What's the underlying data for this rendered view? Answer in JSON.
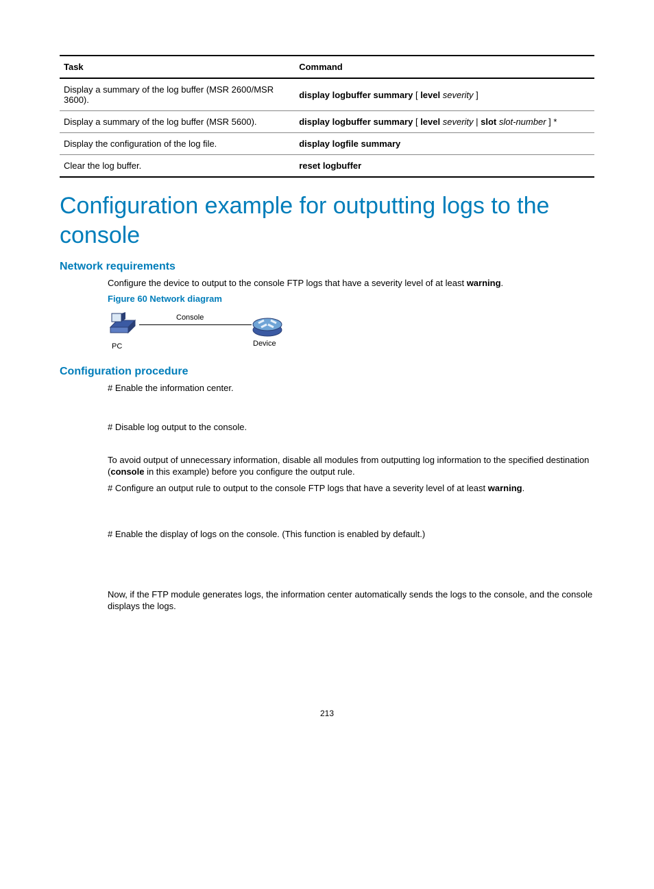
{
  "table": {
    "headers": {
      "task": "Task",
      "command": "Command"
    },
    "rows": [
      {
        "task": "Display a summary of the log buffer (MSR 2600/MSR 3600).",
        "cmd_parts": {
          "p1": "display logbuffer summary",
          "p2": " [ ",
          "p3": "level",
          "p4": " ",
          "p5": "severity",
          "p6": " ]"
        }
      },
      {
        "task": "Display a summary of the log buffer (MSR 5600).",
        "cmd_parts": {
          "p1": "display logbuffer summary",
          "p2": " [ ",
          "p3": "level",
          "p4": " ",
          "p5": "severity",
          "p6": " | ",
          "p7": "slot",
          "p8": " ",
          "p9": "slot-number",
          "p10": " ] *"
        }
      },
      {
        "task": "Display the configuration of the log file.",
        "cmd_simple": "display logfile summary"
      },
      {
        "task": "Clear the log buffer.",
        "cmd_simple": "reset logbuffer"
      }
    ]
  },
  "heading": "Configuration example for outputting logs to the console",
  "section1": {
    "title": "Network requirements",
    "para": {
      "a": "Configure the device to output to the console FTP logs that have a severity level of at least ",
      "b": "warning",
      "c": "."
    },
    "figcap": "Figure 60 Network diagram",
    "labels": {
      "pc": "PC",
      "device": "Device",
      "console": "Console"
    }
  },
  "section2": {
    "title": "Configuration procedure",
    "p1": "# Enable the information center.",
    "p2": "# Disable log output to the console.",
    "p3": {
      "a": "To avoid output of unnecessary information, disable all modules from outputting log information to the specified destination (",
      "b": "console",
      "c": " in this example) before you configure the output rule."
    },
    "p4": {
      "a": "# Configure an output rule to output to the console FTP logs that have a severity level of at least ",
      "b": "warning",
      "c": "."
    },
    "p5": "# Enable the display of logs on the console. (This function is enabled by default.)",
    "p6": "Now, if the FTP module generates logs, the information center automatically sends the logs to the console, and the console displays the logs."
  },
  "page_number": "213"
}
